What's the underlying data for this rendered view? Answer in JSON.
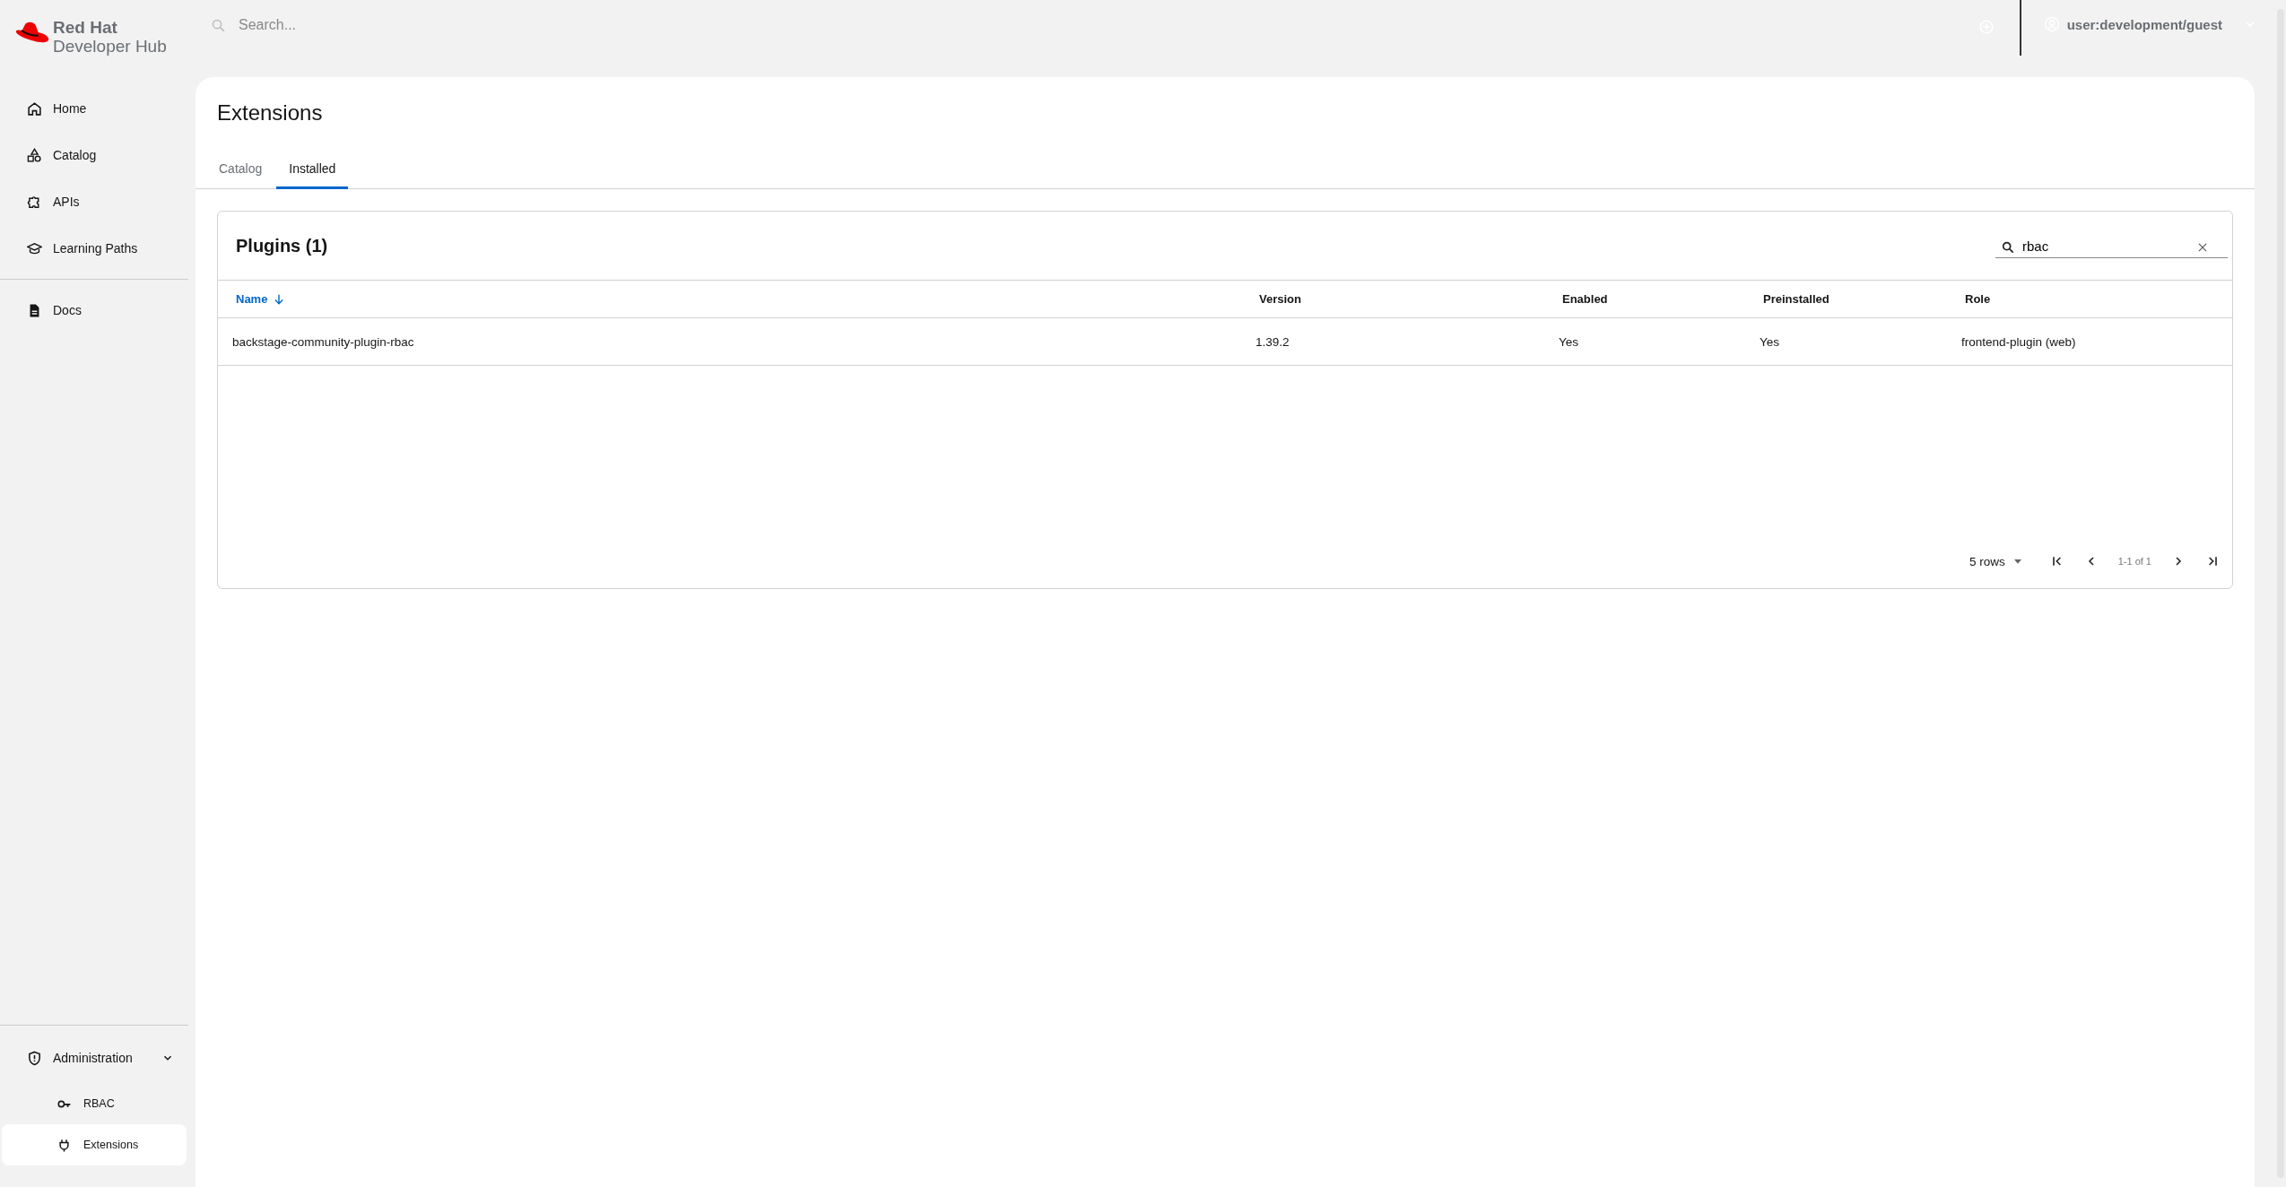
{
  "logo": {
    "line_1": "Red Hat",
    "line_2": "Developer Hub"
  },
  "header": {
    "search": {
      "placeholder": "Search..."
    },
    "user": "user:development/guest"
  },
  "sidebar": {
    "items": [
      {
        "label": "Home",
        "selected": false
      },
      {
        "label": "Catalog",
        "selected": false
      },
      {
        "label": "APIs",
        "selected": false
      },
      {
        "label": "Learning Paths",
        "selected": false
      }
    ],
    "docs": [
      {
        "label": "Docs",
        "selected": false
      }
    ],
    "admin": {
      "label": "Administration",
      "expanded": true,
      "children": [
        {
          "label": "RBAC",
          "selected": false
        },
        {
          "label": "Extensions",
          "selected": true
        }
      ]
    }
  },
  "page": {
    "title": "Extensions",
    "tabs": [
      {
        "label": "Catalog",
        "selected": false
      },
      {
        "label": "Installed",
        "selected": true
      }
    ]
  },
  "table": {
    "title": "Plugins (1)",
    "search": {
      "value": "rbac"
    },
    "columns": [
      {
        "label": "Name",
        "sorted": true
      },
      {
        "label": "Version",
        "sorted": false
      },
      {
        "label": "Enabled",
        "sorted": false
      },
      {
        "label": "Preinstalled",
        "sorted": false
      },
      {
        "label": "Role",
        "sorted": false
      }
    ],
    "rows": [
      [
        "backstage-community-plugin-rbac",
        "1.39.2",
        "Yes",
        "Yes",
        "frontend-plugin (web)"
      ]
    ],
    "pagination": {
      "rows_per_page": "5 rows",
      "range": "1-1 of 1"
    }
  }
}
